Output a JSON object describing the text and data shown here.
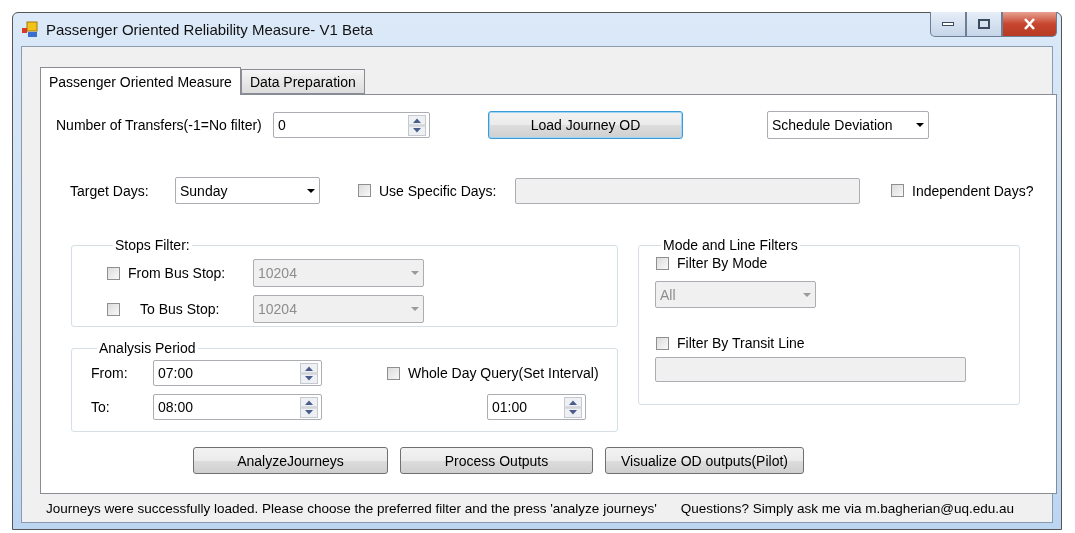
{
  "window": {
    "title": "Passenger Oriented Reliability Measure- V1 Beta"
  },
  "tabs": [
    {
      "label": "Passenger Oriented Measure",
      "selected": true
    },
    {
      "label": "Data Preparation",
      "selected": false
    }
  ],
  "transfers": {
    "label": "Number of Transfers(-1=No filter)",
    "value": "0"
  },
  "load_button": {
    "label": "Load Journey OD",
    "focused": true
  },
  "measure_select": {
    "value": "Schedule Deviation"
  },
  "target_days": {
    "label": "Target Days:",
    "value": "Sunday"
  },
  "specific_days": {
    "label": "Use Specific Days:",
    "checked": false
  },
  "independent_days": {
    "label": "Independent Days?",
    "checked": false
  },
  "stops_filter": {
    "title": "Stops Filter:",
    "rows": [
      {
        "label": "From Bus Stop:",
        "checked": false,
        "value": "10204",
        "disabled": true
      },
      {
        "label": "To Bus Stop:",
        "checked": false,
        "value": "10204",
        "disabled": true
      }
    ]
  },
  "analysis_period": {
    "title": "Analysis Period",
    "from": {
      "label": "From:",
      "value": "07:00"
    },
    "to": {
      "label": "To:",
      "value": "08:00"
    },
    "whole_day": {
      "label": "Whole Day Query(Set Interval)",
      "checked": false
    },
    "interval": {
      "value": "01:00"
    }
  },
  "mode_filters": {
    "title": "Mode and Line Filters",
    "mode": {
      "label": "Filter By Mode",
      "checked": false
    },
    "mode_select": {
      "value": "All",
      "disabled": true
    },
    "line": {
      "label": "Filter By Transit Line",
      "checked": false
    }
  },
  "actions": [
    "AnalyzeJourneys",
    "Process Outputs",
    "Visualize OD outputs(Pilot)"
  ],
  "status_bar": {
    "message": "Journeys were successfully loaded. Please choose the preferred filter and the press 'analyze journeys'",
    "contact": "Questions? Simply ask me via m.bagherian@uq.edu.au"
  }
}
